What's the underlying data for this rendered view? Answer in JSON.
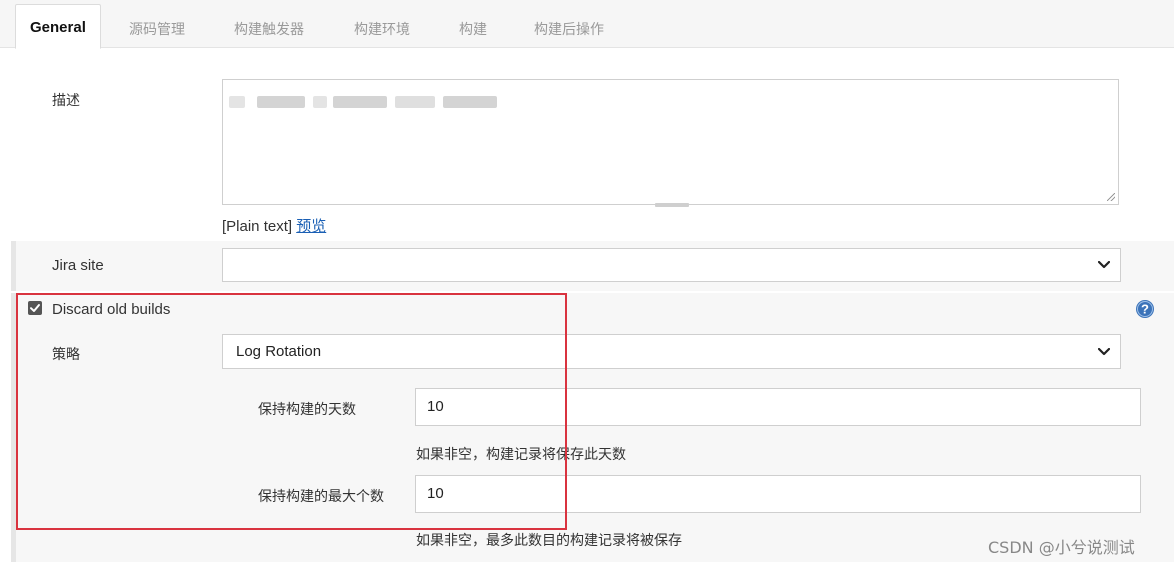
{
  "tabs": [
    {
      "label": "General",
      "active": true
    },
    {
      "label": "源码管理"
    },
    {
      "label": "构建触发器"
    },
    {
      "label": "构建环境"
    },
    {
      "label": "构建"
    },
    {
      "label": "构建后操作"
    }
  ],
  "description": {
    "label": "描述",
    "format_text": "[Plain text]",
    "preview_link": "预览"
  },
  "jira": {
    "label": "Jira site",
    "value": ""
  },
  "discard": {
    "checkbox_label": "Discard old builds",
    "checked": true,
    "strategy_label": "策略",
    "strategy_value": "Log Rotation",
    "days_label": "保持构建的天数",
    "days_value": "10",
    "days_hint": "如果非空，构建记录将保存此天数",
    "max_label": "保持构建的最大个数",
    "max_value": "10",
    "max_hint": "如果非空，最多此数目的构建记录将被保存"
  },
  "watermark": "CSDN @小兮说测试",
  "colors": {
    "highlight_border": "#d9333f",
    "link": "#1a5fb4",
    "help_icon": "#3b73b9"
  },
  "icons": {
    "select_arrow": "chevron-down-icon",
    "help": "help-icon",
    "check": "check-icon"
  }
}
